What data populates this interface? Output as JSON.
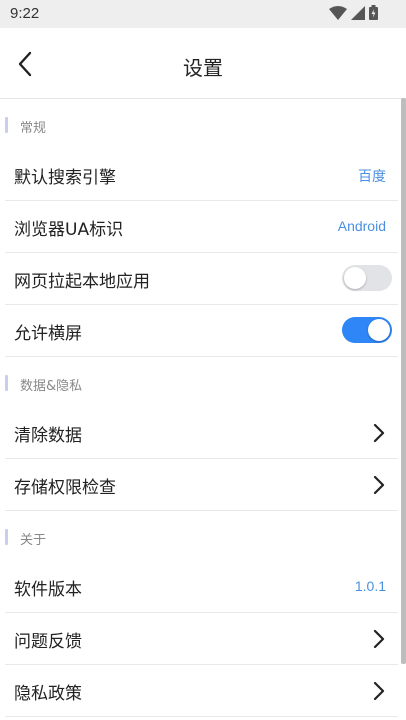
{
  "status_bar": {
    "time": "9:22",
    "icons": [
      "wifi-icon",
      "signal-icon",
      "battery-icon"
    ]
  },
  "header": {
    "title": "设置",
    "back_icon": "chevron-left-icon"
  },
  "sections": [
    {
      "title": "常规",
      "items": [
        {
          "label": "默认搜索引擎",
          "value": "百度"
        },
        {
          "label": "浏览器UA标识",
          "value": "Android"
        },
        {
          "label": "网页拉起本地应用",
          "toggle": false
        },
        {
          "label": "允许横屏",
          "toggle": true
        }
      ]
    },
    {
      "title": "数据&隐私",
      "items": [
        {
          "label": "清除数据",
          "icon": "chevron-right-icon"
        },
        {
          "label": "存储权限检查",
          "icon": "chevron-right-icon"
        }
      ]
    },
    {
      "title": "关于",
      "items": [
        {
          "label": "软件版本",
          "value": "1.0.1"
        },
        {
          "label": "问题反馈",
          "icon": "chevron-right-icon"
        },
        {
          "label": "隐私政策",
          "icon": "chevron-right-icon"
        }
      ]
    }
  ],
  "colors": {
    "accent": "#2f86f6",
    "value_text": "#4a90e2",
    "section_bar": "#c9cdee"
  }
}
